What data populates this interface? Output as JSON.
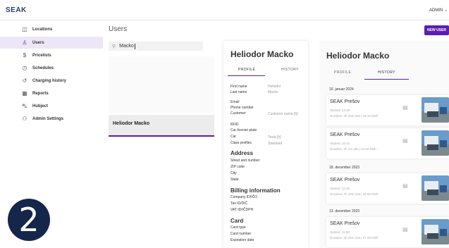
{
  "header": {
    "logo": "SEAK",
    "user_menu": "ADMIN ⌄"
  },
  "sidebar": {
    "items": [
      {
        "label": "Locations",
        "icon": "map-icon",
        "glyph": "◫",
        "active": false
      },
      {
        "label": "Users",
        "icon": "user-icon",
        "glyph": "♙",
        "active": true
      },
      {
        "label": "Pricelists",
        "icon": "dollar-icon",
        "glyph": "$",
        "active": false
      },
      {
        "label": "Schedules",
        "icon": "clock-icon",
        "glyph": "◷",
        "active": false
      },
      {
        "label": "Charging history",
        "icon": "history-icon",
        "glyph": "↺",
        "active": false
      },
      {
        "label": "Reports",
        "icon": "calendar-icon",
        "glyph": "▦",
        "active": false
      },
      {
        "label": "Hubject",
        "icon": "car-icon",
        "glyph": "⛍",
        "active": false
      },
      {
        "label": "Admin Settings",
        "icon": "admin-users-icon",
        "glyph": "⚇",
        "active": false
      }
    ]
  },
  "step_badge": "2",
  "users": {
    "title": "Users",
    "search_value": "Macko",
    "search_icon": "search-icon",
    "new_user_label": "NEW USER",
    "selected_user": "Heliodor Macko"
  },
  "detail": {
    "name": "Heliodor Macko",
    "tabs": [
      "PROFILE",
      "HISTORY"
    ],
    "rows": [
      {
        "label": "First name",
        "value": "Heliodor"
      },
      {
        "label": "Last name",
        "value": "Macko"
      },
      {
        "label": "Email",
        "value": ""
      },
      {
        "label": "Phone number",
        "value": ""
      },
      {
        "label": "Customer",
        "value": "Customer name [h]"
      },
      {
        "label": "RFID",
        "value": ""
      },
      {
        "label": "Car license plate",
        "value": ""
      },
      {
        "label": "Car",
        "value": "Tesla [h]"
      },
      {
        "label": "Class profiles",
        "value": "Standard"
      }
    ],
    "address_title": "Address",
    "address_rows": [
      "Street and number",
      "ZIP code",
      "City",
      "State"
    ],
    "billing_title": "Billing information",
    "billing_rows": [
      "Company ID/IČO",
      "Tax ID/DIČ",
      "VAT ID/IČDPH"
    ],
    "card_title": "Card",
    "card_rows": [
      "Card type",
      "Card number",
      "Expiration date"
    ]
  },
  "history": {
    "name": "Heliodor Macko",
    "tabs": [
      "PROFILE",
      "HISTORY"
    ],
    "groups": [
      {
        "date": "16. januar 2024",
        "sessions": [
          {
            "name": "SEAK Prešov",
            "started": "Started: 13:28",
            "duration": "Duration: 3h 35m 36s | 16.10 kWh"
          },
          {
            "name": "SEAK Prešov",
            "started": "Started: 10:41",
            "duration": "Duration: 2h 1m 48s | 24.50 kWh"
          }
        ]
      },
      {
        "date": "18. december 2023",
        "sessions": [
          {
            "name": "SEAK Prešov",
            "started": "Started: 11:48",
            "duration": "Duration: 7h 10m 22s | 45.80 kWh"
          }
        ]
      },
      {
        "date": "13. december 2023",
        "sessions": [
          {
            "name": "SEAK Prešov",
            "started": "Started: 11:58",
            "duration": "Duration: 2h 25m 22s | 27.00 kWh"
          }
        ]
      }
    ]
  },
  "colors": {
    "accent": "#5a1fb0",
    "badge": "#15264a",
    "logo": "#2b3a67"
  }
}
